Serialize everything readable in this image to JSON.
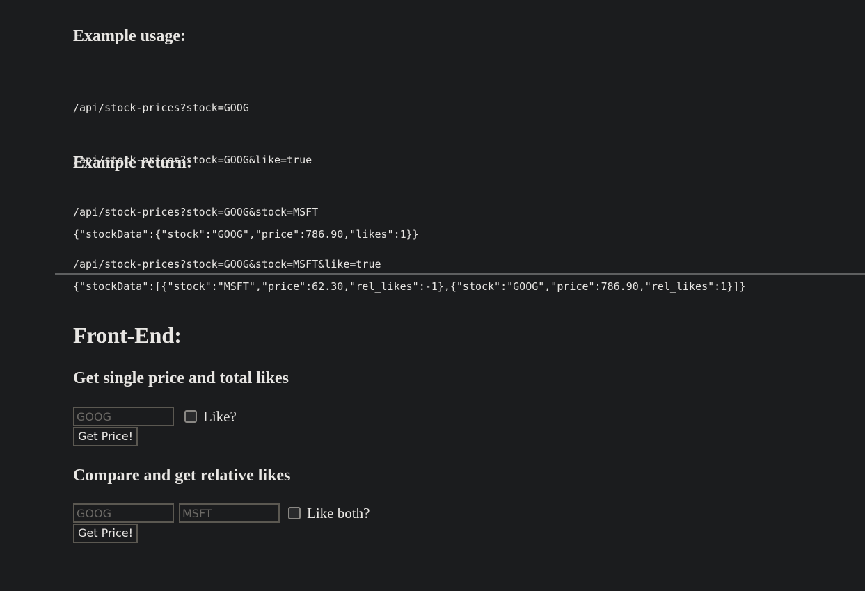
{
  "api": {
    "usage_heading": "Example usage:",
    "usage_lines": [
      "/api/stock-prices?stock=GOOG",
      "/api/stock-prices?stock=GOOG&like=true",
      "/api/stock-prices?stock=GOOG&stock=MSFT",
      "/api/stock-prices?stock=GOOG&stock=MSFT&like=true"
    ],
    "return_heading": "Example return:",
    "return_lines": [
      "{\"stockData\":{\"stock\":\"GOOG\",\"price\":786.90,\"likes\":1}}",
      "{\"stockData\":[{\"stock\":\"MSFT\",\"price\":62.30,\"rel_likes\":-1},{\"stock\":\"GOOG\",\"price\":786.90,\"rel_likes\":1}]}"
    ]
  },
  "frontend": {
    "title": "Front-End:",
    "single": {
      "heading": "Get single price and total likes",
      "stock_placeholder": "GOOG",
      "stock_value": "",
      "like_label": "Like?",
      "like_checked": false,
      "button_label": "Get Price!"
    },
    "compare": {
      "heading": "Compare and get relative likes",
      "stock1_placeholder": "GOOG",
      "stock1_value": "",
      "stock2_placeholder": "MSFT",
      "stock2_value": "",
      "like_label": "Like both?",
      "like_checked": false,
      "button_label": "Get Price!"
    }
  }
}
